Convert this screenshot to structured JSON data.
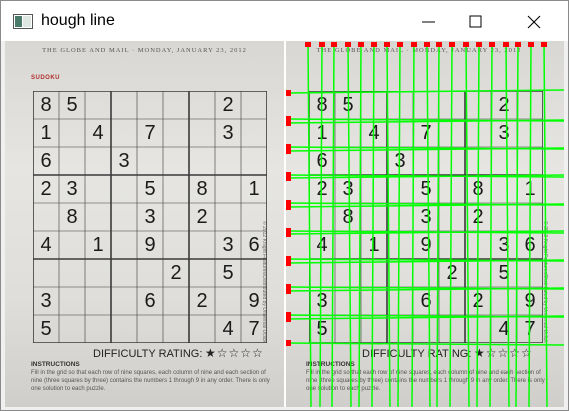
{
  "window": {
    "title": "hough line"
  },
  "paper": {
    "header": "THE GLOBE AND MAIL  ·  MONDAY, JANUARY 23, 2012",
    "section": "SUDOKU",
    "edge_text": "© 2012 Knight Features/Distributed by Universal Uclick",
    "rating_label": "DIFFICULTY RATING:",
    "stars": "★☆☆☆☆",
    "instructions_title": "INSTRUCTIONS",
    "instructions_text": "Fill in the grid so that each row of nine squares, each column of nine and each section of nine (three squares by three) contains the numbers 1 through 9 in any order. There is only one solution to each puzzle."
  },
  "sudoku": [
    [
      "8",
      "5",
      "",
      "",
      "",
      "",
      "",
      "2",
      ""
    ],
    [
      "1",
      "",
      "4",
      "",
      "7",
      "",
      "",
      "3",
      ""
    ],
    [
      "6",
      "",
      "",
      "3",
      "",
      "",
      "",
      "",
      ""
    ],
    [
      "2",
      "3",
      "",
      "",
      "5",
      "",
      "8",
      "",
      "1"
    ],
    [
      "",
      "8",
      "",
      "",
      "3",
      "",
      "2",
      "",
      ""
    ],
    [
      "4",
      "",
      "1",
      "",
      "9",
      "",
      "",
      "3",
      "6"
    ],
    [
      "",
      "",
      "",
      "",
      "",
      "2",
      "",
      "5",
      ""
    ],
    [
      "3",
      "",
      "",
      "",
      "6",
      "",
      "2",
      "",
      "9"
    ],
    [
      "5",
      "",
      "",
      "",
      "",
      "",
      "",
      "4",
      "7"
    ]
  ],
  "colors": {
    "hough_line": "#00ff00",
    "endpoint": "#ff0000"
  }
}
